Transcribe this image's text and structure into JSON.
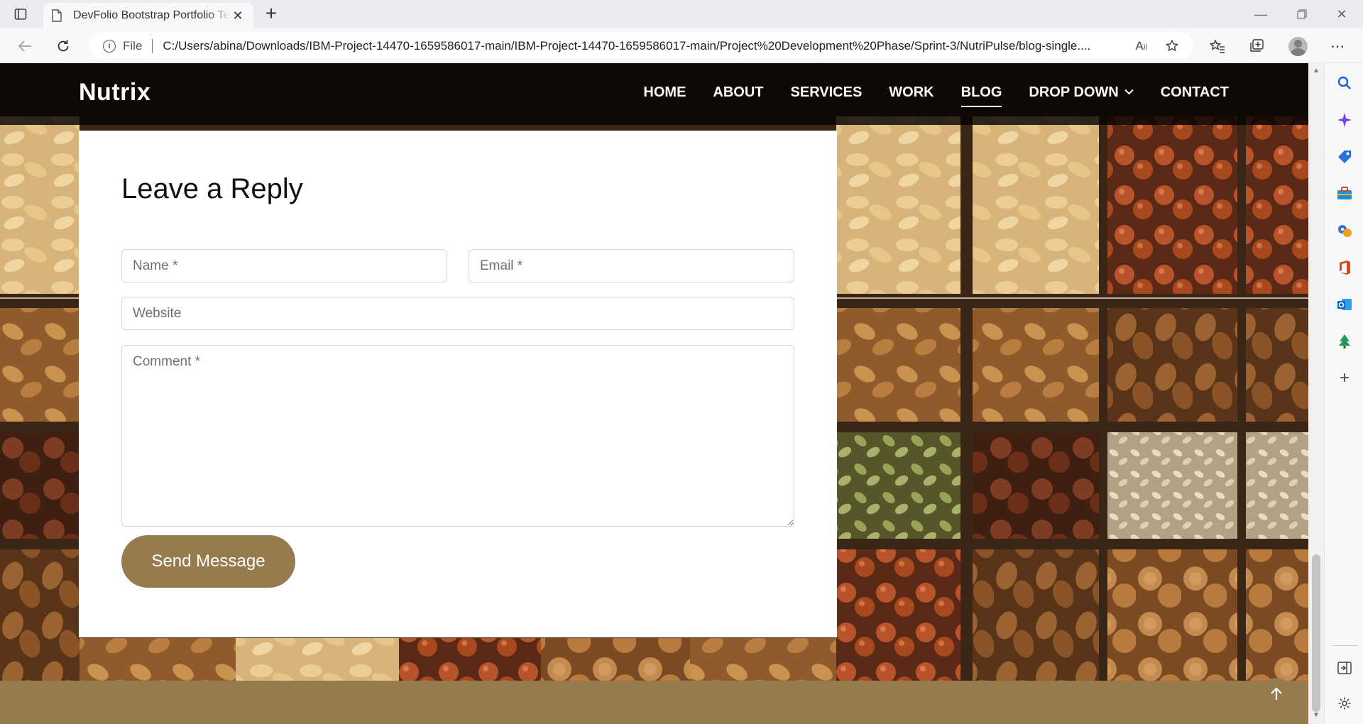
{
  "browser": {
    "tab_title": "DevFolio Bootstrap Portfolio Template",
    "new_tab_label": "+",
    "address_protocol": "File",
    "address_url": "C:/Users/abina/Downloads/IBM-Project-14470-1659586017-main/IBM-Project-14470-1659586017-main/Project%20Development%20Phase/Sprint-3/NutriPulse/blog-single...."
  },
  "site": {
    "brand": "Nutrix",
    "menu": [
      {
        "label": "HOME"
      },
      {
        "label": "ABOUT"
      },
      {
        "label": "SERVICES"
      },
      {
        "label": "WORK"
      },
      {
        "label": "BLOG",
        "active": true
      },
      {
        "label": "DROP DOWN",
        "has_dropdown": true
      },
      {
        "label": "CONTACT"
      }
    ]
  },
  "reply_form": {
    "title": "Leave a Reply",
    "name_placeholder": "Name *",
    "email_placeholder": "Email *",
    "website_placeholder": "Website",
    "comment_placeholder": "Comment *",
    "submit_label": "Send Message"
  },
  "colors": {
    "accent": "#977a4d",
    "nav_bg": "#060402",
    "card_bg": "#ffffff"
  }
}
